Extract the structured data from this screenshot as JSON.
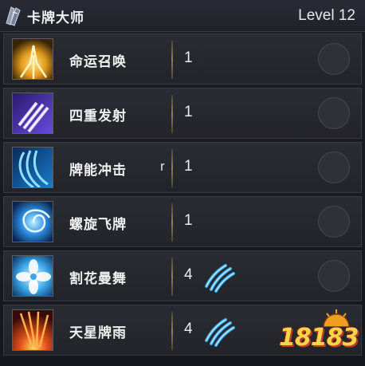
{
  "header": {
    "title": "卡牌大师",
    "level": "Level 12"
  },
  "skills": [
    {
      "name": "命运召唤",
      "hotkey": "",
      "rank": "1",
      "has_claw": false,
      "icon": "destiny-gold-burst-icon"
    },
    {
      "name": "四重发射",
      "hotkey": "",
      "rank": "1",
      "has_claw": false,
      "icon": "quad-shot-purple-icon"
    },
    {
      "name": "牌能冲击",
      "hotkey": "r",
      "rank": "1",
      "has_claw": false,
      "icon": "card-impact-blue-icon"
    },
    {
      "name": "螺旋飞牌",
      "hotkey": "",
      "rank": "1",
      "has_claw": false,
      "icon": "spiral-card-blue-icon"
    },
    {
      "name": "割花曼舞",
      "hotkey": "",
      "rank": "4",
      "has_claw": true,
      "icon": "flower-dance-icon"
    },
    {
      "name": "天星牌雨",
      "hotkey": "",
      "rank": "4",
      "has_claw": true,
      "icon": "star-card-rain-icon"
    }
  ],
  "watermark": "18183"
}
